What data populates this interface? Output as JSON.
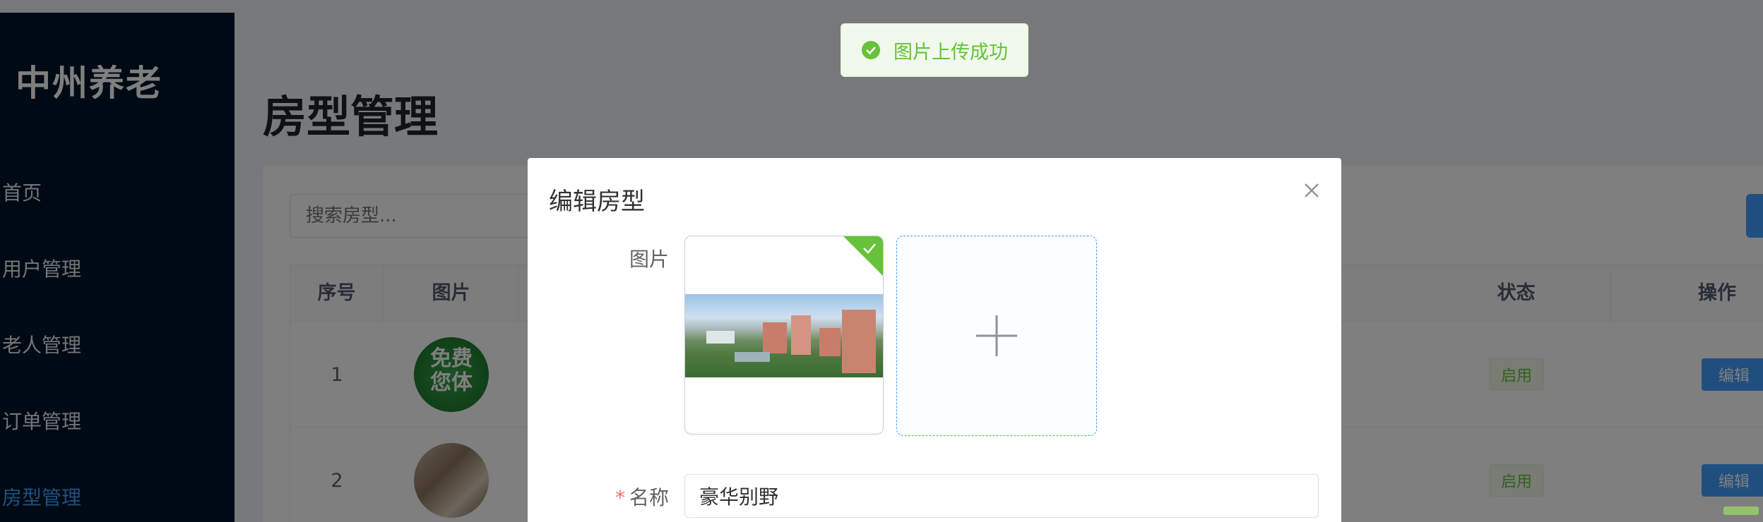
{
  "sidebar": {
    "brand": "中州养老",
    "items": [
      {
        "label": "首页"
      },
      {
        "label": "用户管理"
      },
      {
        "label": "老人管理"
      },
      {
        "label": "订单管理"
      },
      {
        "label": "房型管理",
        "active": true
      }
    ]
  },
  "main": {
    "title": "房型管理",
    "search_placeholder": "搜索房型...",
    "table": {
      "headers": {
        "index": "序号",
        "image": "图片",
        "status": "状态",
        "actions": "操作"
      },
      "rows": [
        {
          "index": "1",
          "thumb_text": "免费\n您体",
          "status": "启用",
          "edit_label": "编辑"
        },
        {
          "index": "2",
          "thumb_text": "",
          "status": "启用",
          "edit_label": "编辑"
        }
      ]
    }
  },
  "dialog": {
    "title": "编辑房型",
    "image_label": "图片",
    "name_label": "名称",
    "name_value": "豪华别野"
  },
  "toast": {
    "text": "图片上传成功"
  },
  "colors": {
    "sidebar_bg": "#001529",
    "primary": "#409eff",
    "success": "#67c23a",
    "danger": "#f56c6c"
  }
}
